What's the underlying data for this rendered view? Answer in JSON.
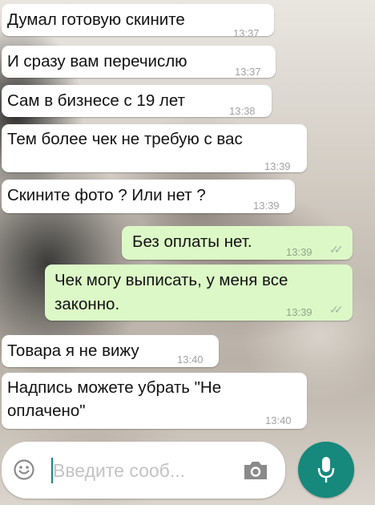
{
  "messages": [
    {
      "text": "Думал готовую скините",
      "time": "13:37"
    },
    {
      "text": "И сразу вам перечислю",
      "time": "13:37"
    },
    {
      "text": "Сам в бизнесе с 19 лет",
      "time": "13:38"
    },
    {
      "text": "Тем более чек не требую с вас",
      "time": "13:39"
    },
    {
      "text": "Скините фото ? Или нет ?",
      "time": "13:39"
    },
    {
      "text": "Без оплаты нет.",
      "time": "13:39",
      "read": true
    },
    {
      "text_line1": "Чек могу выписать, у меня все",
      "text_line2": "законно.",
      "time": "13:39",
      "read": true
    },
    {
      "text": "Товара я не вижу",
      "time": "13:40"
    },
    {
      "text_line1": "Надпись можете убрать \"Не",
      "text_line2": "оплачено\"",
      "time": "13:40"
    }
  ],
  "composer": {
    "placeholder": "Введите сооб...",
    "emoji_icon": "smiley-icon",
    "camera_icon": "camera-icon",
    "mic_icon": "microphone-icon"
  },
  "colors": {
    "incoming_bubble": "#ffffff",
    "outgoing_bubble": "#dcf8c6",
    "accent": "#16887c",
    "read_ticks": "#9db7a2"
  }
}
